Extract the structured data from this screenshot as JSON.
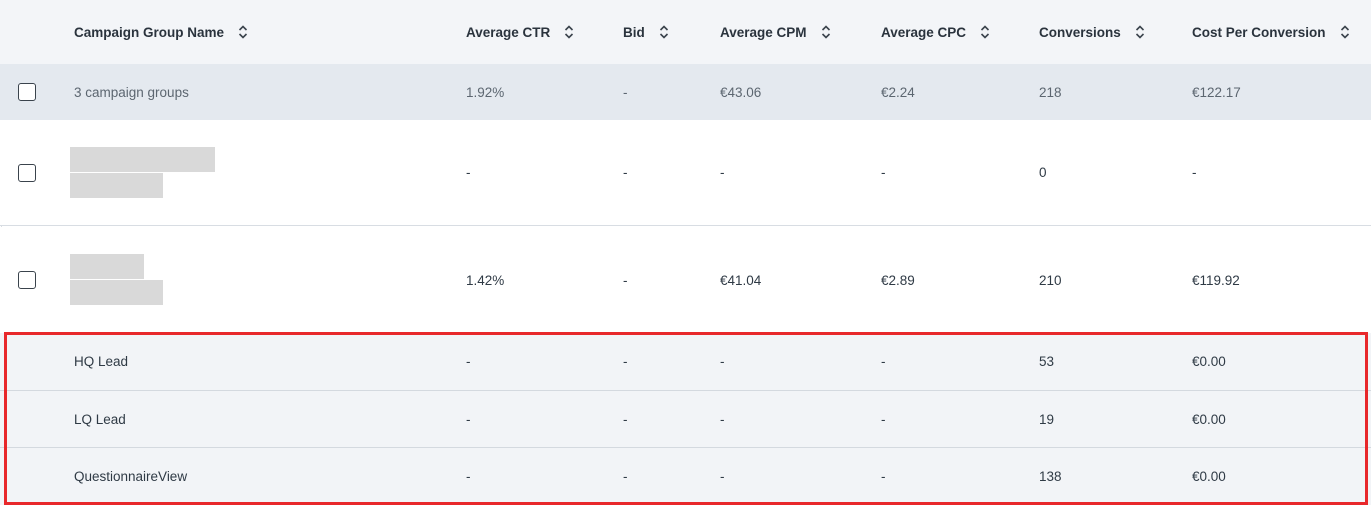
{
  "columns": {
    "name": "Campaign Group Name",
    "ctr": "Average CTR",
    "bid": "Bid",
    "cpm": "Average CPM",
    "cpc": "Average CPC",
    "conversions": "Conversions",
    "cost_per_conversion": "Cost Per Conversion"
  },
  "summary": {
    "name": "3 campaign groups",
    "ctr": "1.92%",
    "bid": "-",
    "cpm": "€43.06",
    "cpc": "€2.24",
    "conversions": "218",
    "cost_per_conversion": "€122.17"
  },
  "groups": [
    {
      "ctr": "-",
      "bid": "-",
      "cpm": "-",
      "cpc": "-",
      "conversions": "0",
      "cost_per_conversion": "-"
    },
    {
      "ctr": "1.42%",
      "bid": "-",
      "cpm": "€41.04",
      "cpc": "€2.89",
      "conversions": "210",
      "cost_per_conversion": "€119.92"
    }
  ],
  "conversions": [
    {
      "name": "HQ Lead",
      "ctr": "-",
      "bid": "-",
      "cpm": "-",
      "cpc": "-",
      "conversions": "53",
      "cost_per_conversion": "€0.00"
    },
    {
      "name": "LQ Lead",
      "ctr": "-",
      "bid": "-",
      "cpm": "-",
      "cpc": "-",
      "conversions": "19",
      "cost_per_conversion": "€0.00"
    },
    {
      "name": "QuestionnaireView",
      "ctr": "-",
      "bid": "-",
      "cpm": "-",
      "cpc": "-",
      "conversions": "138",
      "cost_per_conversion": "€0.00"
    }
  ],
  "colors": {
    "highlight": "#e8282b",
    "header_bg": "#f3f5f8",
    "summary_bg": "#e4e9ef"
  },
  "icons": {
    "sort": "sort-up-down-icon"
  }
}
